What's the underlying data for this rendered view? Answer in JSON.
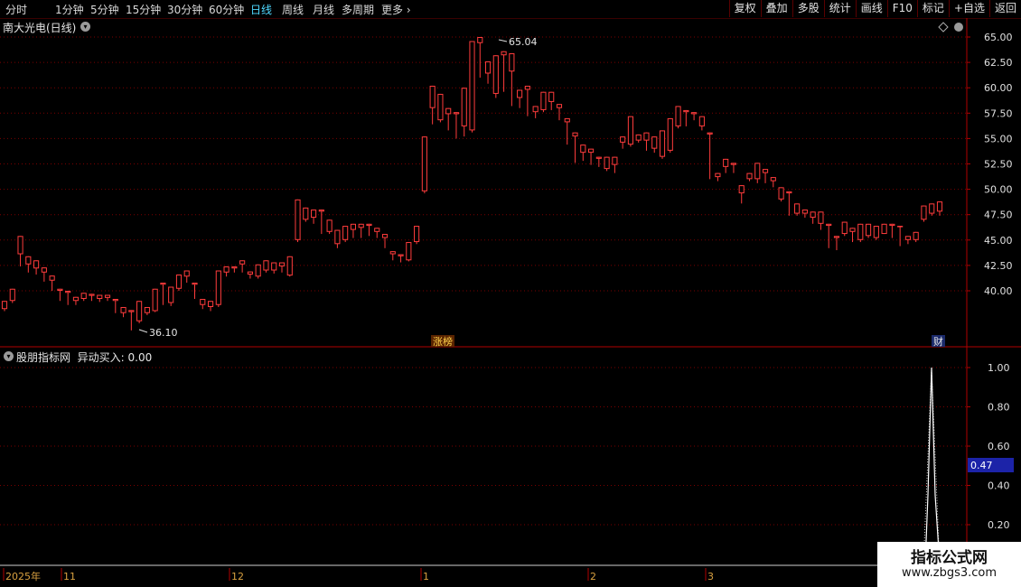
{
  "toolbar": {
    "periods": [
      "分时",
      "1分钟",
      "5分钟",
      "15分钟",
      "30分钟",
      "60分钟",
      "日线",
      "周线",
      "月线",
      "多周期",
      "更多"
    ],
    "active_period": "日线",
    "tools": [
      "复权",
      "叠加",
      "多股",
      "统计",
      "画线",
      "F10",
      "标记",
      "+自选",
      "返回"
    ]
  },
  "main_chart": {
    "title": "南大光电(日线)",
    "high_label": "65.04",
    "low_label": "36.10",
    "badge_limit": "涨榜",
    "badge_finance": "财",
    "y_ticks": [
      "65.00",
      "62.50",
      "60.00",
      "57.50",
      "55.00",
      "52.50",
      "50.00",
      "47.50",
      "45.00",
      "42.50",
      "40.00"
    ]
  },
  "indicator": {
    "title": "股朋指标网",
    "label": "异动买入: 0.00",
    "y_ticks": [
      "1.00",
      "0.80",
      "0.60",
      "0.40",
      "0.20"
    ],
    "current_value": "0.47"
  },
  "x_axis": {
    "labels": [
      "2025年",
      "11",
      "12",
      "1",
      "2",
      "3"
    ]
  },
  "watermark": {
    "title": "指标公式网",
    "url": "www.zbgs3.com"
  },
  "colors": {
    "up": "#ff3c3c",
    "down": "#4fe8ff",
    "grid": "#7a0000",
    "axis": "#b00000",
    "active": "#4fd8ff",
    "value_badge": "#1c23a8"
  },
  "chart_data": {
    "type": "candlestick",
    "y_range": [
      38,
      66.5
    ],
    "candles": [
      [
        38.2,
        39.0,
        38.0,
        38.4
      ],
      [
        39.0,
        40.2,
        38.8,
        40.0
      ],
      [
        43.6,
        45.4,
        42.4,
        42.6
      ],
      [
        42.6,
        43.4,
        41.8,
        42.2
      ],
      [
        42.2,
        43.0,
        41.6,
        42.4
      ],
      [
        41.8,
        42.3,
        40.9,
        41.2
      ],
      [
        41.0,
        41.5,
        40.0,
        40.2
      ],
      [
        40.0,
        40.2,
        39.0,
        39.8
      ],
      [
        39.8,
        40.0,
        38.6,
        39.0
      ],
      [
        39.0,
        39.4,
        38.6,
        39.2
      ],
      [
        39.2,
        39.8,
        39.0,
        39.6
      ],
      [
        39.5,
        39.7,
        39.0,
        39.3
      ],
      [
        39.2,
        39.6,
        38.9,
        39.4
      ],
      [
        39.3,
        39.6,
        39.0,
        39.3
      ],
      [
        39.0,
        39.2,
        37.8,
        38.0
      ],
      [
        37.8,
        38.4,
        37.4,
        38.2
      ],
      [
        37.9,
        38.1,
        36.1,
        36.8
      ],
      [
        37.0,
        39.0,
        36.8,
        38.2
      ],
      [
        37.8,
        38.4,
        37.6,
        38.2
      ],
      [
        38.0,
        40.2,
        37.9,
        39.6
      ],
      [
        40.6,
        40.8,
        38.6,
        38.8
      ],
      [
        38.8,
        40.4,
        38.5,
        40.1
      ],
      [
        40.2,
        41.6,
        40.0,
        41.4
      ],
      [
        41.4,
        42.0,
        40.8,
        41.4
      ],
      [
        40.6,
        40.8,
        39.2,
        39.4
      ],
      [
        38.6,
        39.2,
        38.2,
        39.0
      ],
      [
        38.4,
        39.0,
        38.0,
        38.4
      ],
      [
        38.6,
        42.0,
        38.4,
        41.8
      ],
      [
        41.8,
        42.4,
        41.4,
        42.0
      ],
      [
        42.2,
        42.4,
        41.8,
        42.2
      ],
      [
        42.6,
        43.0,
        41.8,
        42.2
      ],
      [
        41.6,
        41.9,
        41.2,
        41.6
      ],
      [
        41.4,
        42.6,
        41.2,
        42.3
      ],
      [
        42.0,
        43.0,
        41.8,
        42.4
      ],
      [
        42.0,
        42.8,
        41.7,
        42.6
      ],
      [
        42.4,
        42.8,
        41.8,
        42.0
      ],
      [
        41.5,
        43.4,
        41.4,
        43.2
      ],
      [
        45.0,
        49.0,
        44.8,
        48.8
      ],
      [
        47.0,
        48.2,
        46.8,
        47.4
      ],
      [
        47.2,
        48.0,
        46.6,
        47.6
      ],
      [
        47.8,
        48.0,
        45.6,
        45.6
      ],
      [
        45.8,
        47.0,
        45.6,
        45.8
      ],
      [
        44.6,
        46.0,
        44.2,
        45.4
      ],
      [
        45.0,
        46.4,
        44.8,
        46.2
      ],
      [
        46.0,
        46.6,
        45.2,
        46.4
      ],
      [
        46.2,
        46.6,
        45.2,
        46.2
      ],
      [
        46.4,
        46.6,
        45.4,
        45.8
      ],
      [
        45.8,
        46.2,
        45.2,
        45.2
      ],
      [
        45.2,
        45.6,
        44.2,
        44.4
      ],
      [
        43.6,
        43.9,
        43.0,
        43.2
      ],
      [
        43.4,
        43.6,
        42.8,
        43.0
      ],
      [
        43.0,
        44.8,
        42.9,
        44.6
      ],
      [
        44.8,
        46.4,
        44.6,
        46.2
      ],
      [
        49.8,
        55.2,
        49.6,
        55.0
      ],
      [
        58.0,
        60.2,
        56.4,
        57.2
      ],
      [
        56.8,
        59.4,
        56.6,
        57.2
      ],
      [
        57.4,
        58.0,
        55.8,
        57.8
      ],
      [
        57.4,
        57.6,
        55.0,
        55.2
      ],
      [
        56.2,
        60.0,
        55.2,
        59.8
      ],
      [
        55.8,
        64.6,
        55.6,
        63.8
      ],
      [
        64.4,
        65.0,
        61.0,
        61.2
      ],
      [
        61.4,
        62.6,
        60.4,
        60.4
      ],
      [
        59.4,
        63.2,
        59.0,
        62.8
      ],
      [
        63.2,
        63.6,
        59.6,
        60.2
      ],
      [
        61.6,
        63.4,
        58.2,
        58.4
      ],
      [
        59.0,
        59.8,
        58.0,
        59.8
      ],
      [
        59.8,
        60.2,
        57.2,
        57.6
      ],
      [
        57.6,
        58.2,
        57.0,
        57.4
      ],
      [
        57.8,
        59.6,
        57.6,
        58.2
      ],
      [
        58.6,
        59.6,
        57.8,
        59.0
      ],
      [
        58.0,
        58.4,
        56.8,
        57.0
      ],
      [
        56.6,
        57.0,
        54.4,
        55.0
      ],
      [
        55.2,
        55.6,
        52.6,
        52.8
      ],
      [
        53.6,
        54.4,
        52.8,
        53.8
      ],
      [
        53.6,
        54.0,
        52.4,
        53.4
      ],
      [
        53.0,
        53.2,
        52.2,
        52.8
      ],
      [
        52.0,
        53.2,
        51.8,
        52.6
      ],
      [
        52.4,
        53.2,
        51.6,
        52.6
      ],
      [
        54.6,
        55.2,
        54.0,
        55.0
      ],
      [
        54.4,
        57.2,
        54.2,
        55.2
      ],
      [
        54.8,
        55.4,
        54.6,
        54.8
      ],
      [
        54.8,
        55.6,
        53.8,
        54.4
      ],
      [
        54.0,
        55.2,
        53.6,
        54.2
      ],
      [
        53.2,
        55.8,
        53.0,
        54.0
      ],
      [
        53.8,
        57.0,
        53.6,
        56.8
      ],
      [
        56.2,
        58.2,
        56.0,
        57.8
      ],
      [
        57.6,
        57.8,
        56.2,
        57.6
      ],
      [
        57.4,
        57.6,
        56.8,
        57.2
      ],
      [
        56.2,
        57.2,
        55.8,
        56.2
      ],
      [
        55.4,
        55.6,
        51.0,
        51.2
      ],
      [
        51.2,
        51.6,
        50.8,
        51.0
      ],
      [
        52.2,
        53.0,
        51.6,
        52.4
      ],
      [
        52.4,
        52.6,
        51.6,
        51.8
      ],
      [
        49.6,
        50.4,
        48.6,
        50.0
      ],
      [
        51.0,
        51.6,
        50.8,
        51.2
      ],
      [
        51.0,
        52.6,
        50.6,
        52.2
      ],
      [
        51.6,
        52.0,
        50.6,
        50.8
      ],
      [
        50.8,
        51.2,
        50.2,
        50.4
      ],
      [
        49.0,
        50.2,
        48.8,
        49.8
      ],
      [
        49.6,
        49.8,
        47.4,
        47.6
      ],
      [
        47.6,
        48.6,
        47.4,
        47.6
      ],
      [
        47.6,
        48.0,
        47.2,
        47.2
      ],
      [
        47.2,
        47.8,
        46.6,
        46.8
      ],
      [
        46.6,
        47.8,
        46.0,
        47.6
      ],
      [
        46.4,
        46.6,
        44.2,
        44.4
      ],
      [
        45.2,
        45.4,
        44.0,
        45.0
      ],
      [
        45.6,
        46.8,
        45.4,
        46.4
      ],
      [
        45.8,
        46.2,
        44.8,
        45.2
      ],
      [
        45.0,
        46.6,
        44.8,
        46.2
      ],
      [
        45.4,
        46.6,
        45.2,
        46.4
      ],
      [
        45.2,
        46.4,
        45.0,
        46.2
      ],
      [
        45.6,
        46.6,
        45.6,
        45.8
      ],
      [
        46.4,
        46.6,
        45.2,
        45.8
      ],
      [
        46.4,
        46.4,
        44.4,
        44.6
      ],
      [
        45.0,
        45.4,
        44.6,
        45.2
      ],
      [
        45.0,
        45.8,
        44.8,
        45.4
      ],
      [
        47.0,
        48.4,
        46.8,
        48.2
      ],
      [
        47.6,
        48.6,
        47.4,
        47.8
      ],
      [
        47.8,
        48.8,
        47.4,
        47.8
      ]
    ],
    "indicator_series": {
      "name": "异动买入",
      "values_tail": [
        0.0,
        0.0,
        0.35,
        1.0,
        0.35,
        0.0
      ]
    }
  }
}
